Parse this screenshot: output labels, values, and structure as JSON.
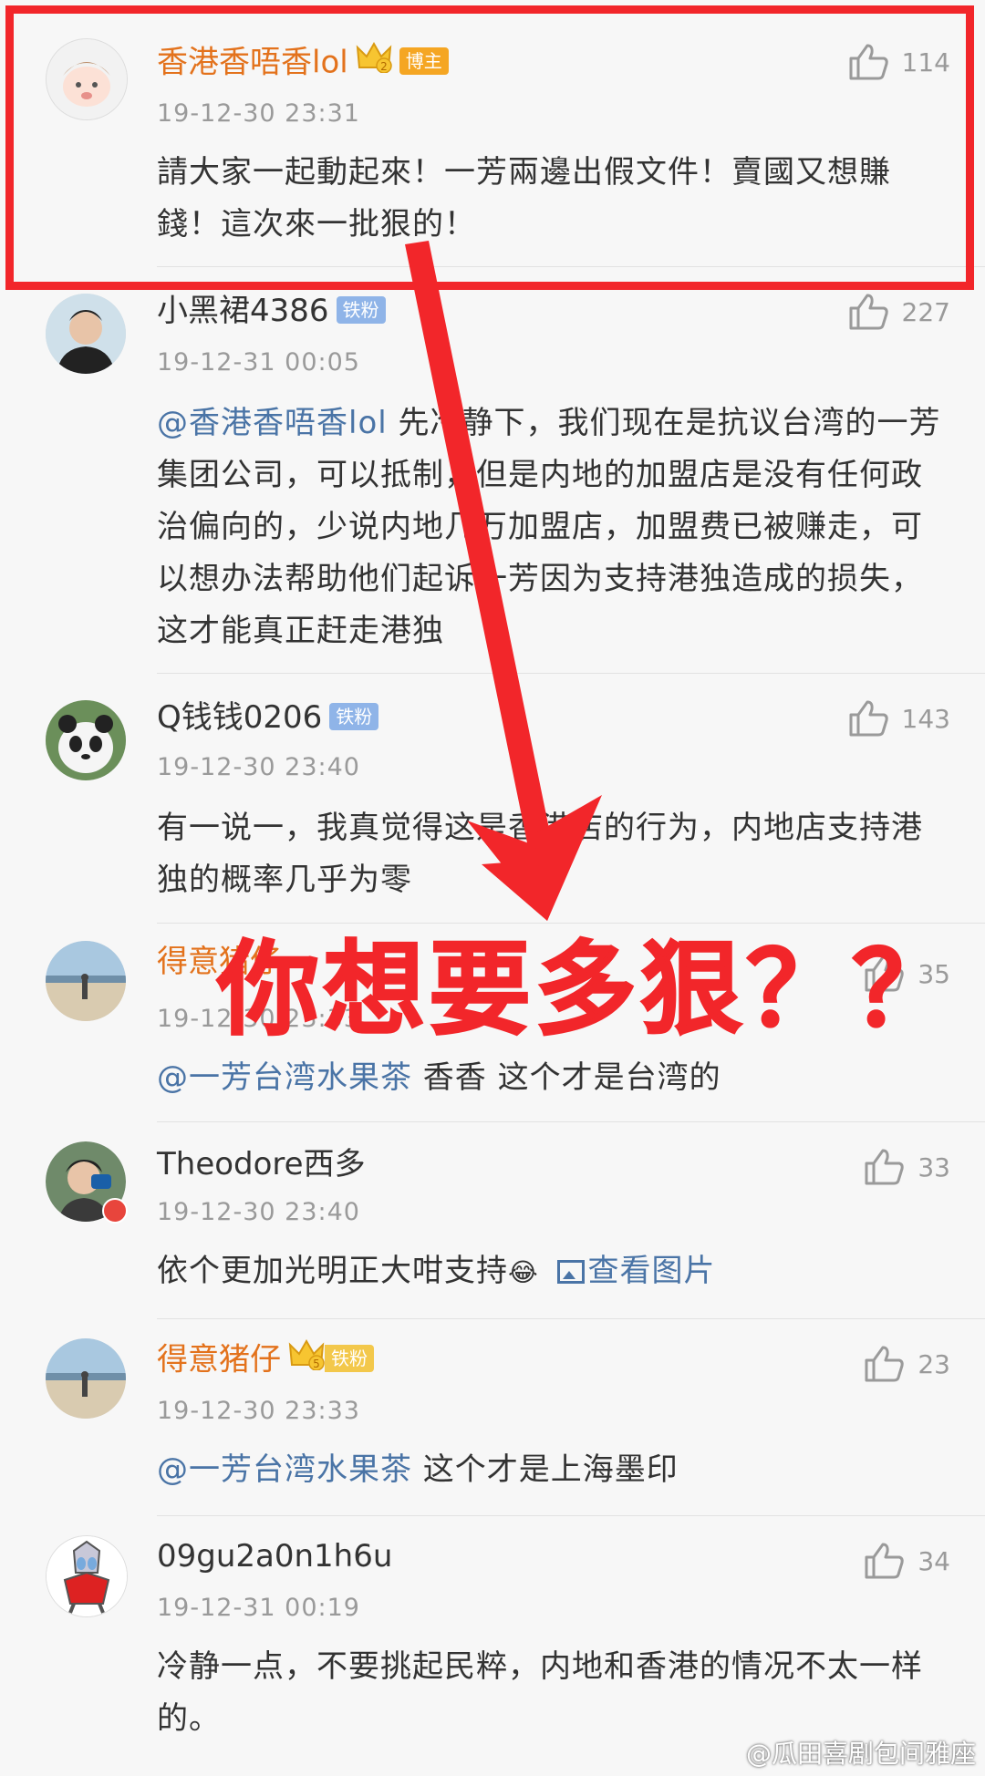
{
  "comments": [
    {
      "name": "香港香唔香lol",
      "badge": "博主",
      "time": "19-12-30 23:31",
      "likes": "114",
      "text": "請大家一起動起來！一芳兩邊出假文件！賣國又想賺錢！這次來一批狠的！"
    },
    {
      "name": "小黑裙4386",
      "badge": "铁粉",
      "time": "19-12-31 00:05",
      "likes": "227",
      "mention": "@香港香唔香lol",
      "text": " 先冷静下，我们现在是抗议台湾的一芳集团公司，可以抵制，但是内地的加盟店是没有任何政治偏向的，少说内地几万加盟店，加盟费已被赚走，可以想办法帮助他们起诉一芳因为支持港独造成的损失，这才能真正赶走港独"
    },
    {
      "name": "Q钱钱0206",
      "badge": "铁粉",
      "time": "19-12-30 23:40",
      "likes": "143",
      "text": "有一说一，我真觉得这是香港店的行为，内地店支持港独的概率几乎为零"
    },
    {
      "name": "得意猪仔",
      "time": "19-12-30 23:33",
      "likes": "35",
      "mention": "@一芳台湾水果茶",
      "text": " 香香 这个才是台湾的"
    },
    {
      "name": "Theodore西多",
      "time": "19-12-30 23:40",
      "likes": "33",
      "text": "依个更加光明正大咁支持",
      "emoji": "😂",
      "image_link": "查看图片"
    },
    {
      "name": "得意猪仔",
      "badge": "铁粉",
      "time": "19-12-30 23:33",
      "likes": "23",
      "mention": "@一芳台湾水果茶",
      "text": " 这个才是上海墨印"
    },
    {
      "name": "09gu2a0n1h6u",
      "time": "19-12-31 00:19",
      "likes": "34",
      "text": "冷静一点，不要挑起民粹，内地和香港的情况不太一样的。"
    }
  ],
  "overlay": {
    "caption": "你想要多狠？？",
    "color": "#f2262a"
  },
  "watermark": "@瓜田喜剧包间雅座",
  "colors": {
    "vip_name": "#e3721c",
    "mention": "#4a74a6",
    "fan_badge": "#8fb4e8",
    "host_badge": "#f5a623"
  }
}
